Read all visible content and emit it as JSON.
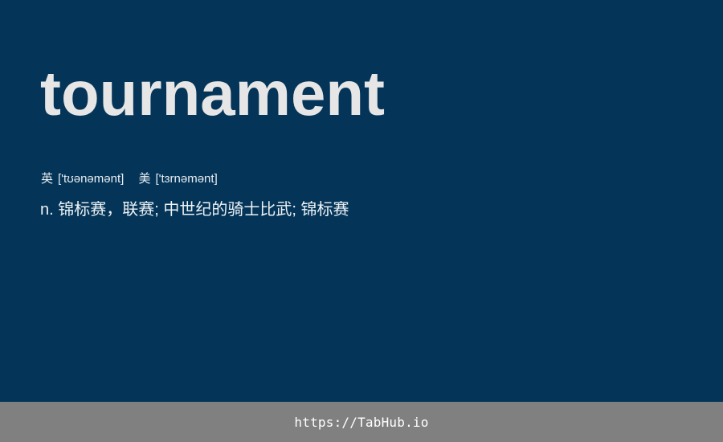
{
  "word": "tournament",
  "phonetics": {
    "uk": {
      "label": "英",
      "ipa": "['tʊənəmənt]"
    },
    "us": {
      "label": "美",
      "ipa": "['tɜrnəmənt]"
    }
  },
  "definition": "n. 锦标赛，联赛; 中世纪的骑士比武; 锦标赛",
  "footer": {
    "link_text": "https://TabHub.io"
  },
  "colors": {
    "background": "#043558",
    "word": "#e6e6e6",
    "footer_background": "#808080"
  }
}
